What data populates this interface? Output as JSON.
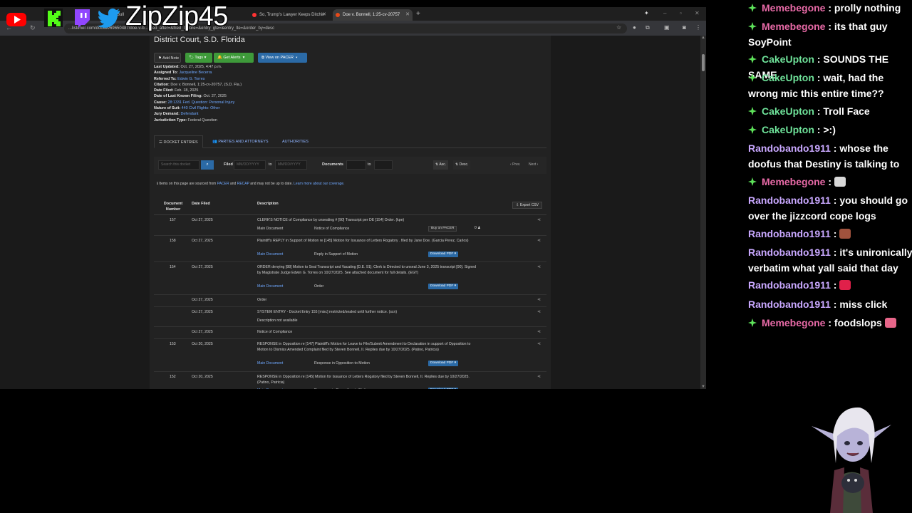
{
  "browser": {
    "tabs": [
      {
        "label": "Bull",
        "favicon_color": "#888888",
        "active": false
      },
      {
        "label": "So, Trump's Lawyer Keeps Ditchin",
        "favicon_color": "#ff3333",
        "active": false
      },
      {
        "label": "Doe v. Bonnell, 1:25-cv-20757",
        "favicon_color": "#e64a19",
        "active": true
      }
    ],
    "url": "...listener.com/docket/69650487/doe-v-b... filed_after=&filed_before=&entry_gte=&entry_lte=&order_by=desc"
  },
  "docket": {
    "court": "District Court, S.D. Florida",
    "buttons": {
      "add_note": "Add Note",
      "tags": "Tags",
      "get_alerts": "Get Alerts",
      "view_on_pacer": "View on PACER"
    },
    "meta": [
      {
        "label": "Last Updated:",
        "value": "Oct. 27, 2025, 4:47 p.m.",
        "link": false
      },
      {
        "label": "Assigned To:",
        "value": "Jacqueline Becerra",
        "link": true
      },
      {
        "label": "Referred To:",
        "value": "Edwin G. Torres",
        "link": true
      },
      {
        "label": "Citation:",
        "value": "Doe v. Bonnell, 1:25-cv-20757, (S.D. Fla.)",
        "link": false
      },
      {
        "label": "Date Filed:",
        "value": "Feb. 18, 2025",
        "link": false
      },
      {
        "label": "Date of Last Known Filing:",
        "value": "Oct. 27, 2025",
        "link": false
      },
      {
        "label": "Cause:",
        "value": "28:1331 Fed. Question: Personal Injury",
        "link": true
      },
      {
        "label": "Nature of Suit:",
        "value": "440 Civil Rights: Other",
        "link": true
      },
      {
        "label": "Jury Demand:",
        "value": "Defendant",
        "link": true
      },
      {
        "label": "Jurisdiction Type:",
        "value": "Federal Question",
        "link": false
      }
    ],
    "tabs": {
      "docket_entries": "DOCKET ENTRIES",
      "parties": "PARTIES AND ATTORNEYS",
      "authorities": "AUTHORITIES"
    },
    "filters": {
      "search_placeholder": "Search this docket",
      "filed_label": "Filed",
      "date_placeholder": "MM/DD/YYYY",
      "to_label": "to",
      "documents_label": "Documents",
      "asc": "Asc.",
      "desc": "Desc.",
      "prev": "Prev.",
      "next": "Next"
    },
    "info": {
      "pre": "Items on this page are sourced from",
      "pacer": "PACER",
      "and": "and",
      "recap": "RECAP",
      "post": "and may not be up to date.",
      "learn": "Learn more about our coverage."
    },
    "table_headers": {
      "doc_number": "Document Number",
      "date_filed": "Date Filed",
      "description": "Description",
      "export": "Export CSV"
    },
    "entries": [
      {
        "num": "157",
        "date": "Oct 27, 2025",
        "desc": "CLERK'S NOTICE of Compliance by unsealing # [90] Transcript per DE [154] Order. (kpe)",
        "doc": "Main Document",
        "doc_link": false,
        "type": "Notice of Compliance",
        "action": "Buy on PACER",
        "count": "0"
      },
      {
        "num": "158",
        "date": "Oct 27, 2025",
        "desc": "Plaintiff's REPLY in Support of Motion re [145] Motion for Issuance of Letters Rogatory . filed by Jane Doe. (Garcia Perez, Carlos)",
        "doc": "Main Document",
        "doc_link": true,
        "type": "Reply in Support of Motion",
        "action": "Download PDF"
      },
      {
        "num": "154",
        "date": "Oct 27, 2025",
        "desc": "ORDER denying [88] Motion to Seal Transcript and Vacating [D.E. 91]; Clerk is Directed to unseal June 3, 2025 transcript [90]. Signed by Magistrate Judge Edwin G. Torres on 10/27/2025. See attached document for full details. (EGT)",
        "doc": "Main Document",
        "doc_link": true,
        "type": "Order",
        "action": "Download PDF"
      },
      {
        "num": "",
        "date": "Oct 27, 2025",
        "desc": "Order"
      },
      {
        "num": "",
        "date": "Oct 27, 2025",
        "desc": "SYSTEM ENTRY - Docket Entry 155 [misc] restricted/sealed until further notice. (scn)",
        "note": "Description not available"
      },
      {
        "num": "",
        "date": "Oct 27, 2025",
        "desc": "Notice of Compliance"
      },
      {
        "num": "153",
        "date": "Oct 20, 2025",
        "desc": "RESPONSE in Opposition re [147] Plaintiff's Motion for Leave to File/Submit Amendment to Declaration in support of Opposition to Motion to Dismiss Amended Complaint filed by Steven Bonnell, II. Replies due by 10/27/2025. (Patino, Patricia)",
        "doc": "Main Document",
        "doc_link": true,
        "type": "Response in Opposition to Motion",
        "action": "Download PDF"
      },
      {
        "num": "152",
        "date": "Oct 20, 2025",
        "desc": "RESPONSE in Opposition re [145] Motion for Issuance of Letters Rogatory filed by Steven Bonnell, II. Replies due by 10/27/2025. (Patino, Patricia)",
        "doc": "Main Document",
        "doc_link": true,
        "type": "Response in Opposition to Motion",
        "action": "Download PDF"
      }
    ]
  },
  "overlay": {
    "brand": "ZipZip45",
    "social_icons": [
      "youtube-icon",
      "kick-icon",
      "twitch-icon",
      "twitter-icon"
    ]
  },
  "chat": [
    {
      "user": "Memebegone",
      "color": "pink",
      "badge": true,
      "text": "prolly nothing"
    },
    {
      "user": "Memebegone",
      "color": "pink",
      "badge": true,
      "text": "its that guy SoyPoint"
    },
    {
      "user": "CakeUpton",
      "color": "green",
      "badge": true,
      "text": "SOUNDS THE SAME"
    },
    {
      "user": "CakeUpton",
      "color": "green",
      "badge": true,
      "text": "wait, had the wrong mic this entire time??"
    },
    {
      "user": "CakeUpton",
      "color": "green",
      "badge": true,
      "text": "Troll Face"
    },
    {
      "user": "CakeUpton",
      "color": "green",
      "badge": true,
      "text": ">:)"
    },
    {
      "user": "Randobando1911",
      "color": "purple",
      "badge": false,
      "text": "whose the doofus that Destiny is talking to"
    },
    {
      "user": "Memebegone",
      "color": "pink",
      "badge": true,
      "text": "",
      "emote": "#d8d8d8"
    },
    {
      "user": "Randobando1911",
      "color": "purple",
      "badge": false,
      "text": "you should go over the jizzcord cope logs"
    },
    {
      "user": "Randobando1911",
      "color": "purple",
      "badge": false,
      "text": "",
      "emote": "#a0523d"
    },
    {
      "user": "Randobando1911",
      "color": "purple",
      "badge": false,
      "text": "it's unironically verbatim what yall said that day"
    },
    {
      "user": "Randobando1911",
      "color": "purple",
      "badge": false,
      "text": "",
      "emote": "#e0204a"
    },
    {
      "user": "Randobando1911",
      "color": "purple",
      "badge": false,
      "text": "miss click"
    },
    {
      "user": "Memebegone",
      "color": "pink",
      "badge": true,
      "text": "foodslops",
      "emote": "#e8668a"
    }
  ]
}
